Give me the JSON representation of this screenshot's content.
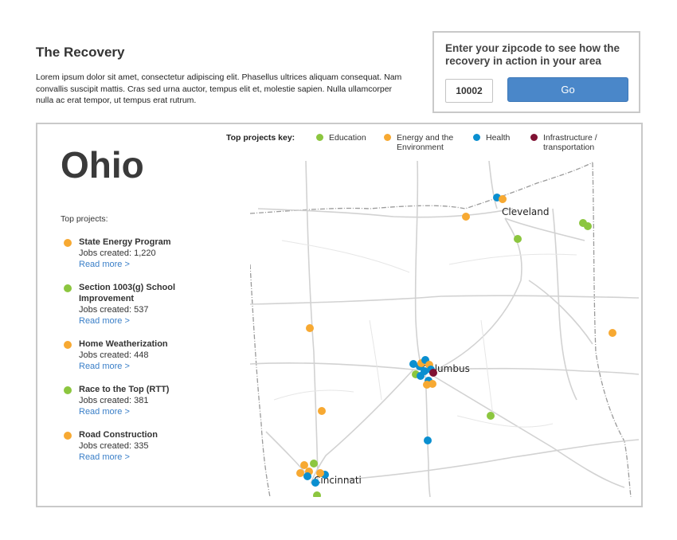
{
  "header": {
    "title": "The Recovery",
    "intro": "Lorem ipsum dolor sit amet, consectetur adipiscing elit. Phasellus ultrices aliquam consequat. Nam convallis suscipit mattis. Cras sed urna auctor, tempus elit et, molestie sapien. Nulla ullamcorper nulla ac erat tempor, ut tempus erat rutrum."
  },
  "zip_widget": {
    "prompt": "Enter your zipcode to see how the recovery in action in your area",
    "zip_value": "10002",
    "go_label": "Go"
  },
  "state": {
    "name": "Ohio",
    "top_projects_label": "Top projects:",
    "projects": [
      {
        "name": "State Energy Program",
        "jobs": "Jobs created: 1,220",
        "link": "Read more >",
        "category": "energy"
      },
      {
        "name": "Section 1003(g) School Improvement",
        "jobs": "Jobs created: 537",
        "link": "Read more >",
        "category": "education"
      },
      {
        "name": "Home Weatherization",
        "jobs": "Jobs created: 448",
        "link": "Read more >",
        "category": "energy"
      },
      {
        "name": "Race to the Top (RTT)",
        "jobs": "Jobs created: 381",
        "link": "Read more >",
        "category": "education"
      },
      {
        "name": "Road Construction",
        "jobs": "Jobs created: 335",
        "link": "Read more >",
        "category": "energy"
      }
    ]
  },
  "key": {
    "title": "Top projects key:",
    "items": [
      {
        "label": "Education",
        "category": "education"
      },
      {
        "label": "Energy and the Environment",
        "category": "energy"
      },
      {
        "label": "Health",
        "category": "health"
      },
      {
        "label": "Infrastructure / transportation",
        "category": "infrastructure"
      }
    ]
  },
  "colors": {
    "education": "#8cc63f",
    "energy": "#f7a932",
    "health": "#0a8fd0",
    "infrastructure": "#7f1133",
    "go_button": "#4a87c9",
    "link": "#3a7fc8"
  },
  "map": {
    "cities": [
      "Cleveland",
      "Columbus",
      "Cincinnati"
    ]
  }
}
